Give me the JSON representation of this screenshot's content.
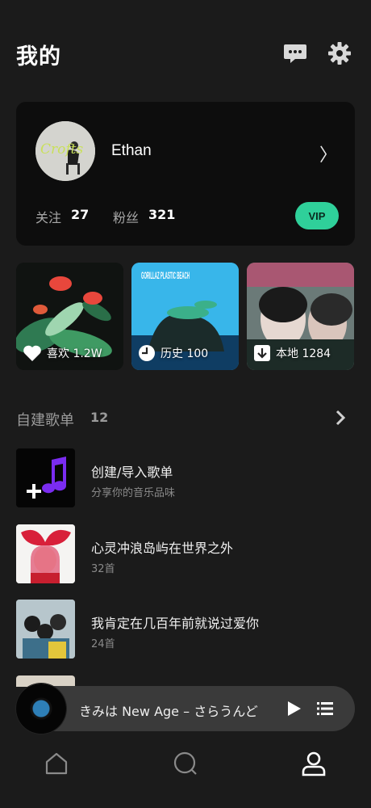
{
  "header": {
    "title": "我的"
  },
  "profile": {
    "name": "Ethan",
    "avatar_text": "Crofts",
    "follow_label": "关注",
    "follow_count": "27",
    "fans_label": "粉丝",
    "fans_count": "321",
    "vip_label": "VIP"
  },
  "tiles": [
    {
      "label": "喜欢 1.2W",
      "icon": "heart-icon"
    },
    {
      "label": "历史 100",
      "icon": "clock-icon"
    },
    {
      "label": "本地 1284",
      "icon": "download-icon"
    }
  ],
  "tile_art": {
    "history_cover": "GORILLAZ PLASTIC BEACH"
  },
  "section": {
    "title": "自建歌单",
    "count": "12"
  },
  "playlists": [
    {
      "name": "创建/导入歌单",
      "sub": "分享你的音乐品味"
    },
    {
      "name": "心灵冲浪岛屿在世界之外",
      "sub": "32首"
    },
    {
      "name": "我肯定在几百年前就说过爱你",
      "sub": "24首"
    }
  ],
  "player": {
    "now_playing": "きみは New Age  – さらうんど"
  },
  "colors": {
    "accent": "#2fd09a",
    "background": "#1b1b1b",
    "card": "#0d0d0d"
  }
}
